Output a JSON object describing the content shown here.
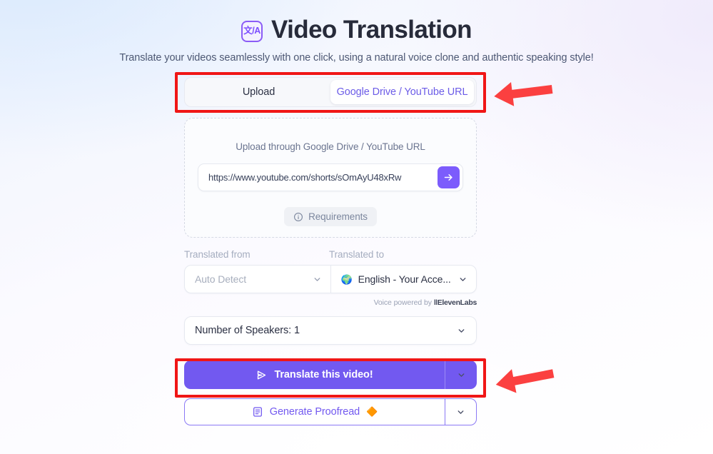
{
  "header": {
    "icon": "translate-icon",
    "icon_glyph": "文/A",
    "title": "Video Translation",
    "subtitle": "Translate your videos seamlessly with one click, using a natural voice clone and authentic speaking style!"
  },
  "tabs": [
    {
      "label": "Upload",
      "active": false
    },
    {
      "label": "Google Drive / YouTube URL",
      "active": true
    }
  ],
  "upload_panel": {
    "hint": "Upload through Google Drive / YouTube URL",
    "url_value": "https://www.youtube.com/shorts/sOmAyU48xRw",
    "url_placeholder": "https://www.youtube.com/shorts/sOmAyU48xRw",
    "submit_icon": "arrow-right-icon",
    "requirements_label": "Requirements",
    "requirements_icon": "info-circle-icon"
  },
  "languages": {
    "from_label": "Translated from",
    "to_label": "Translated to",
    "from_value": "Auto Detect",
    "to_value": "English - Your Acce...",
    "to_icon": "🌍",
    "powered_prefix": "Voice powered by",
    "powered_brand": "ElevenLabs"
  },
  "speakers": {
    "label": "Number of Speakers: 1"
  },
  "primary_button": {
    "label": "Translate this video!",
    "icon": "send-play-icon",
    "caret_icon": "chevron-down-icon"
  },
  "proofread_button": {
    "label": "Generate Proofread",
    "icon": "document-icon",
    "badge": "🔶",
    "caret_icon": "chevron-down-icon"
  },
  "annotations": {
    "highlight_color": "#f01616",
    "arrow_color": "#fb4040",
    "boxes": [
      "tab-switcher",
      "translate-button"
    ],
    "arrows": [
      "arrow-to-tab-switcher",
      "arrow-to-translate-button"
    ]
  },
  "colors": {
    "accent": "#7259f0",
    "tab_active_text": "#6c5ce7",
    "title": "#272b3a"
  }
}
